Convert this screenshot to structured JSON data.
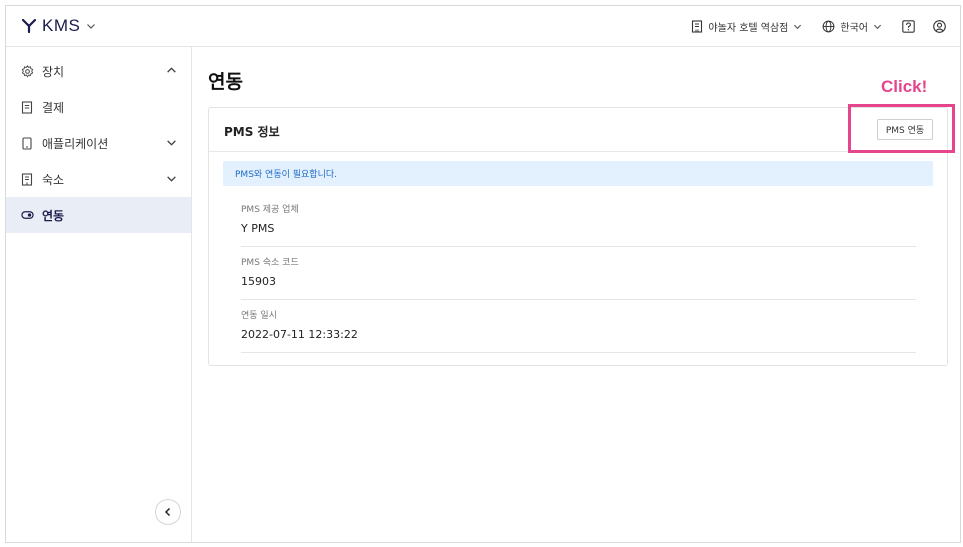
{
  "app": {
    "name": "KMS"
  },
  "header": {
    "property": "야놀자 호텔 역삼점",
    "language": "한국어"
  },
  "sidebar": {
    "items": [
      {
        "label": "장치",
        "icon": "gear-icon",
        "expanded": true
      },
      {
        "label": "결제",
        "icon": "receipt-icon"
      },
      {
        "label": "애플리케이션",
        "icon": "tablet-icon",
        "expandable": true
      },
      {
        "label": "숙소",
        "icon": "building-icon",
        "expandable": true
      },
      {
        "label": "연동",
        "icon": "link-toggle-icon",
        "active": true
      }
    ]
  },
  "main": {
    "title": "연동",
    "annotation": "Click!",
    "card": {
      "title": "PMS 정보",
      "button_label": "PMS 연동",
      "alert": "PMS와 연동이 필요합니다.",
      "fields": [
        {
          "label": "PMS 제공 업체",
          "value": "Y PMS"
        },
        {
          "label": "PMS 숙소 코드",
          "value": "15903"
        },
        {
          "label": "연동 일시",
          "value": "2022-07-11 12:33:22"
        }
      ]
    }
  },
  "colors": {
    "brand": "#1b1b4d",
    "highlight": "#e5458c",
    "alert_bg": "#e3f0fd",
    "alert_text": "#1e6bc6",
    "active_bg": "#e9edf6"
  }
}
